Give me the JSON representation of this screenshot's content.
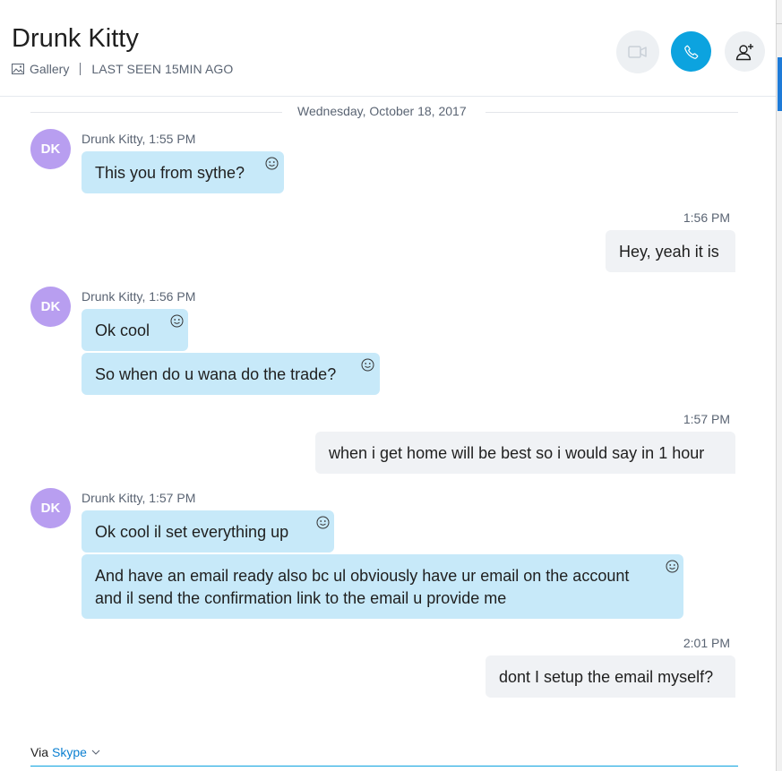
{
  "header": {
    "contact_name": "Drunk Kitty",
    "gallery_label": "Gallery",
    "last_seen": "LAST SEEN 15MIN AGO",
    "video_call_icon": "video-camera-icon",
    "call_icon": "phone-icon",
    "add_person_icon": "add-person-icon"
  },
  "date_divider": "Wednesday, October 18, 2017",
  "avatar_initials": "DK",
  "messages": [
    {
      "sender": "Drunk Kitty",
      "time": "1:55 PM",
      "text": "This you from sythe?"
    },
    {
      "sender": "me",
      "time": "1:56 PM",
      "text": "Hey, yeah it is"
    },
    {
      "sender": "Drunk Kitty",
      "time": "1:56 PM",
      "text": "Ok cool"
    },
    {
      "sender": "Drunk Kitty",
      "text": "So when do u wana do the trade?"
    },
    {
      "sender": "me",
      "time": "1:57 PM",
      "text": "when i get home will be best so i would say in 1 hour"
    },
    {
      "sender": "Drunk Kitty",
      "time": "1:57 PM",
      "text": "Ok cool il set everything up"
    },
    {
      "sender": "Drunk Kitty",
      "text_line1": "And have an email ready also bc ul obviously have ur email on the account",
      "text_line2": "and il send the confirmation link to the email u provide me"
    },
    {
      "sender": "me",
      "time": "2:01 PM",
      "text": "dont I setup the email myself?"
    }
  ],
  "footer": {
    "via_label": "Via",
    "service": "Skype"
  },
  "colors": {
    "accent": "#0ca3df",
    "incoming_bubble": "#c7e9f9",
    "outgoing_bubble": "#f0f2f5",
    "avatar": "#b89ef0"
  }
}
